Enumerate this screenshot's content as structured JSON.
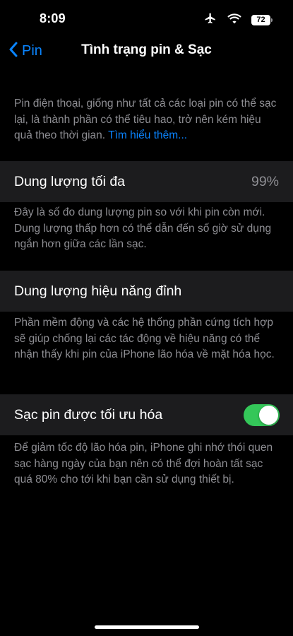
{
  "status_bar": {
    "time": "8:09",
    "battery_level": "72",
    "icons": [
      "airplane-icon",
      "wifi-icon",
      "battery-icon"
    ]
  },
  "nav": {
    "back_label": "Pin",
    "title": "Tình trạng pin & Sạc"
  },
  "intro": {
    "text": "Pin điện thoại, giống như tất cả các loại pin có thể sạc lại, là thành phần có thể tiêu hao, trở nên kém hiệu quả theo thời gian. ",
    "link": "Tìm hiểu thêm..."
  },
  "max_capacity": {
    "label": "Dung lượng tối đa",
    "value": "99%",
    "footnote": "Đây là số đo dung lượng pin so với khi pin còn mới. Dung lượng thấp hơn có thể dẫn đến số giờ sử dụng ngắn hơn giữa các lần sạc."
  },
  "peak_performance": {
    "label": "Dung lượng hiệu năng đỉnh",
    "footnote": "Phần mềm động và các hệ thống phần cứng tích hợp sẽ giúp chống lại các tác động về hiệu năng có thể nhận thấy khi pin của iPhone lão hóa về mặt hóa học."
  },
  "optimized_charging": {
    "label": "Sạc pin được tối ưu hóa",
    "enabled": true,
    "footnote": "Để giảm tốc độ lão hóa pin, iPhone ghi nhớ thói quen sạc hàng ngày của bạn nên có thể đợi hoàn tất sạc quá 80% cho tới khi bạn cần sử dụng thiết bị."
  },
  "colors": {
    "background": "#000000",
    "row_background": "#1c1c1e",
    "accent": "#0a84ff",
    "toggle_on": "#34c759",
    "secondary_text": "#8e8e93"
  }
}
